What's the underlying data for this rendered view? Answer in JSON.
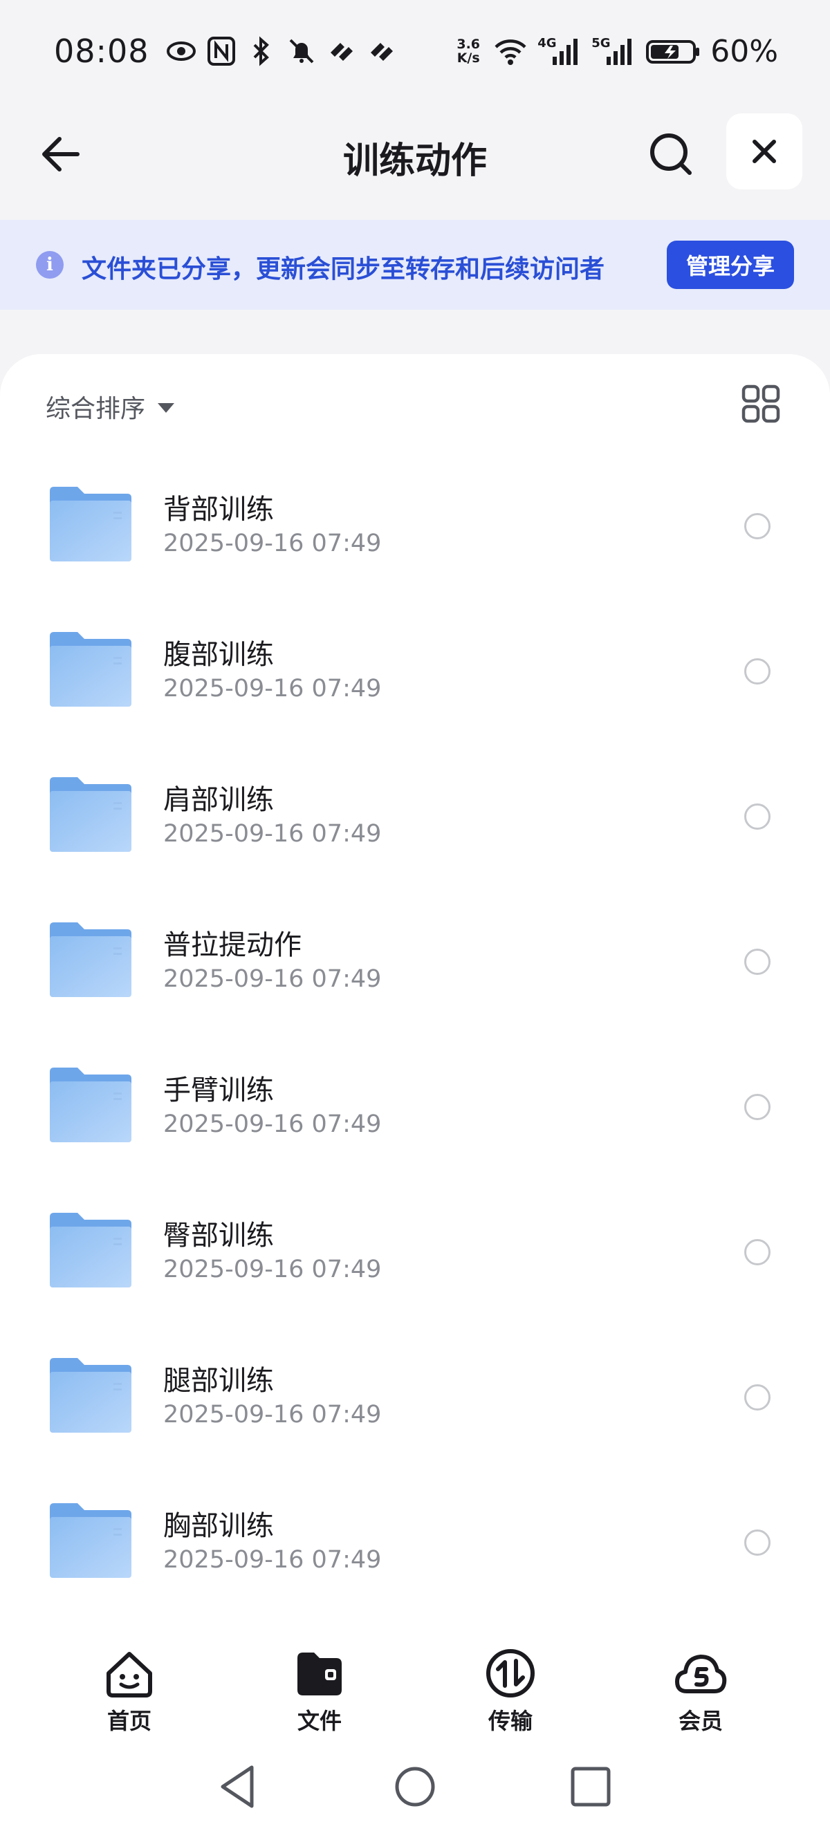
{
  "status_bar": {
    "time": "08:08",
    "net_speed_top": "3.6",
    "net_speed_bottom": "K/s",
    "signal_4g": "4G",
    "signal_5g": "5G",
    "battery": "60%"
  },
  "header": {
    "title": "训练动作"
  },
  "share_banner": {
    "message": "文件夹已分享，更新会同步至转存和后续访问者",
    "button_label": "管理分享"
  },
  "toolbar": {
    "sort_label": "综合排序"
  },
  "files": [
    {
      "name": "背部训练",
      "date": "2025-09-16 07:49"
    },
    {
      "name": "腹部训练",
      "date": "2025-09-16 07:49"
    },
    {
      "name": "肩部训练",
      "date": "2025-09-16 07:49"
    },
    {
      "name": "普拉提动作",
      "date": "2025-09-16 07:49"
    },
    {
      "name": "手臂训练",
      "date": "2025-09-16 07:49"
    },
    {
      "name": "臀部训练",
      "date": "2025-09-16 07:49"
    },
    {
      "name": "腿部训练",
      "date": "2025-09-16 07:49"
    },
    {
      "name": "胸部训练",
      "date": "2025-09-16 07:49"
    }
  ],
  "bottom_nav": {
    "home": "首页",
    "files": "文件",
    "transfer": "传输",
    "member": "会员",
    "active": "files"
  },
  "colors": {
    "accent": "#2b4fe0",
    "banner_bg": "#e7ebfb",
    "folder": "#7fb2ee"
  }
}
